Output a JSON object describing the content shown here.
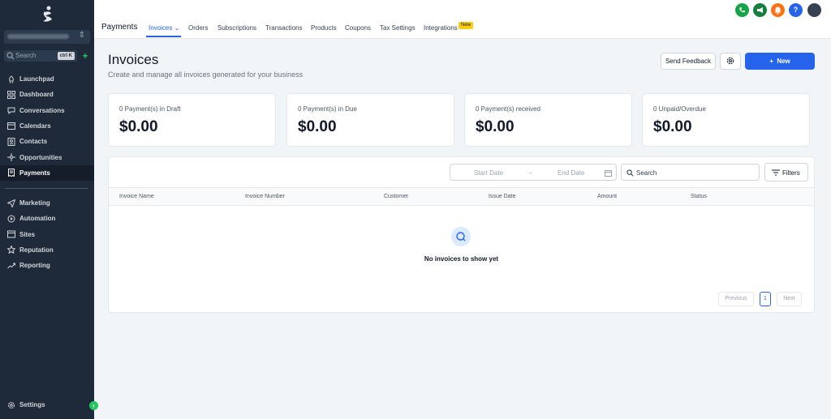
{
  "sidebar": {
    "search_label": "Search",
    "search_shortcut": "ctrl K",
    "items": [
      {
        "label": "Launchpad",
        "icon": "rocket-icon"
      },
      {
        "label": "Dashboard",
        "icon": "grid-icon"
      },
      {
        "label": "Conversations",
        "icon": "chat-icon"
      },
      {
        "label": "Calendars",
        "icon": "calendar-icon"
      },
      {
        "label": "Contacts",
        "icon": "contacts-icon"
      },
      {
        "label": "Opportunities",
        "icon": "funnel-icon"
      },
      {
        "label": "Payments",
        "icon": "receipt-icon"
      }
    ],
    "items2": [
      {
        "label": "Marketing",
        "icon": "send-icon"
      },
      {
        "label": "Automation",
        "icon": "automation-icon"
      },
      {
        "label": "Sites",
        "icon": "sites-icon"
      },
      {
        "label": "Reputation",
        "icon": "star-icon"
      },
      {
        "label": "Reporting",
        "icon": "trend-icon"
      }
    ],
    "settings_label": "Settings",
    "active_item": "Payments"
  },
  "header": {
    "title": "Payments",
    "tabs": [
      "Invoices",
      "Orders",
      "Subscriptions",
      "Transactions",
      "Products",
      "Coupons",
      "Tax Settings",
      "Integrations"
    ],
    "active_tab": "Invoices",
    "new_badge": "New",
    "icon_colors": {
      "phone": "#16a34a",
      "megaphone": "#15803d",
      "bell": "#f97316",
      "help": "#2563eb"
    }
  },
  "page": {
    "title": "Invoices",
    "subtitle": "Create and manage all invoices generated for your business",
    "feedback_label": "Send Feedback",
    "new_label": "New"
  },
  "stats": [
    {
      "label": "0 Payment(s) in Draft",
      "value": "$0.00"
    },
    {
      "label": "0 Payment(s) in Due",
      "value": "$0.00"
    },
    {
      "label": "0 Payment(s) received",
      "value": "$0.00"
    },
    {
      "label": "0 Unpaid/Overdue",
      "value": "$0.00"
    }
  ],
  "table": {
    "start_date_placeholder": "Start Date",
    "end_date_placeholder": "End Date",
    "search_placeholder": "Search",
    "filters_label": "Filters",
    "columns": [
      "Invoice Name",
      "Invoice Number",
      "Customer",
      "Issue Date",
      "Amount",
      "Status"
    ],
    "empty_message": "No invoices to show yet",
    "pagination": {
      "previous": "Previous",
      "page": "1",
      "next": "Next"
    }
  },
  "colors": {
    "accent": "#2563eb",
    "sidebar": "#1e2a3a",
    "success": "#22c55e"
  }
}
